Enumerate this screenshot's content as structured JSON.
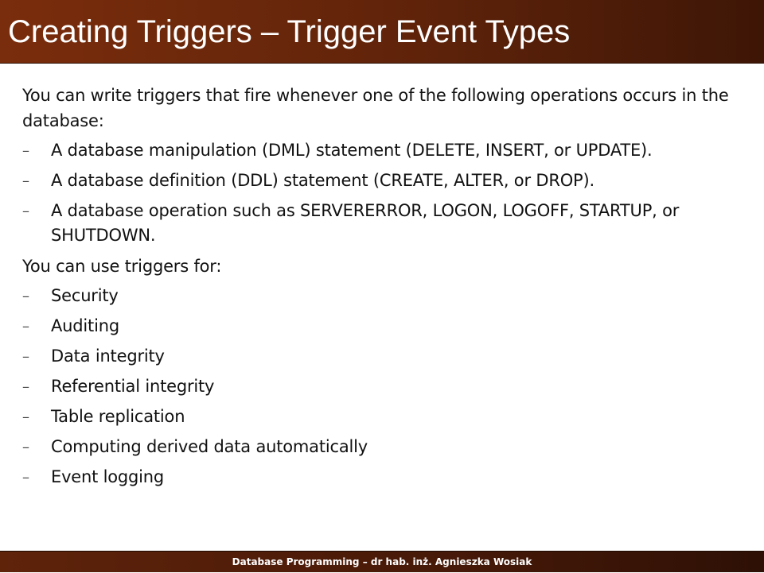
{
  "slide": {
    "title": "Creating Triggers – Trigger Event Types",
    "intro": "You can write triggers that fire whenever one of the following operations occurs in the database:",
    "operations": [
      "A database manipulation (DML) statement (DELETE, INSERT, or UPDATE).",
      "A database definition (DDL) statement (CREATE, ALTER, or DROP).",
      "A database operation such as SERVERERROR, LOGON, LOGOFF, STARTUP, or SHUTDOWN."
    ],
    "uses_intro": "You can use triggers for:",
    "uses": [
      "Security",
      "Auditing",
      "Data integrity",
      "Referential integrity",
      "Table replication",
      "Computing derived data automatically",
      "Event logging"
    ],
    "bullet_glyph": "–",
    "footer": "Database Programming – dr hab. inż. Agnieszka Wosiak"
  },
  "colors": {
    "title_bar": "#5f230a",
    "title_text": "#ffffff",
    "body_text": "#111111",
    "footer_bar": "#461908"
  }
}
